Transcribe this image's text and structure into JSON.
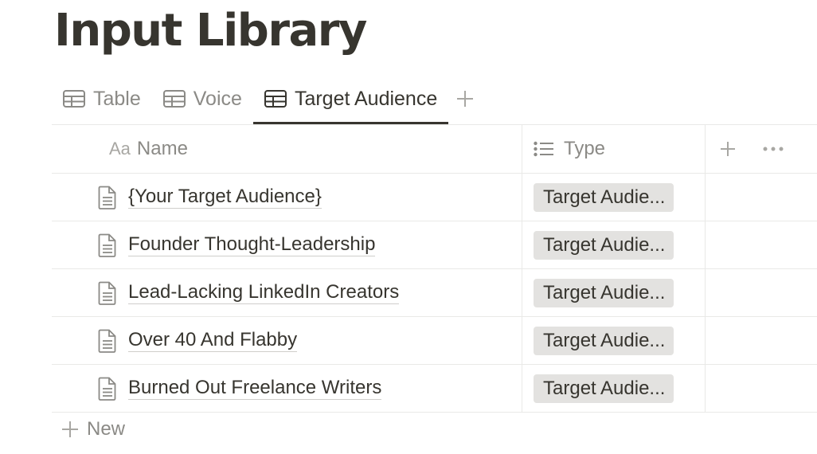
{
  "page": {
    "title": "Input Library"
  },
  "tabs": [
    {
      "label": "Table",
      "icon": "table-icon"
    },
    {
      "label": "Voice",
      "icon": "table-icon"
    },
    {
      "label": "Target Audience",
      "icon": "table-icon",
      "active": true
    }
  ],
  "columns": {
    "name": {
      "prefix": "Aa",
      "label": "Name"
    },
    "type": {
      "label": "Type",
      "icon": "list-icon"
    }
  },
  "rows": [
    {
      "title": "{Your Target Audience}",
      "type": "Target Audie..."
    },
    {
      "title": "Founder Thought-Leadership",
      "type": "Target Audie..."
    },
    {
      "title": "Lead-Lacking LinkedIn Creators",
      "type": "Target Audie..."
    },
    {
      "title": "Over 40 And Flabby",
      "type": "Target Audie..."
    },
    {
      "title": "Burned Out Freelance Writers",
      "type": "Target Audie..."
    }
  ],
  "new_row": {
    "label": "New"
  },
  "colors": {
    "text": "#37352f",
    "muted": "#8b8a86",
    "tag_bg": "#e3e2e0",
    "border": "#e9e9e7"
  }
}
